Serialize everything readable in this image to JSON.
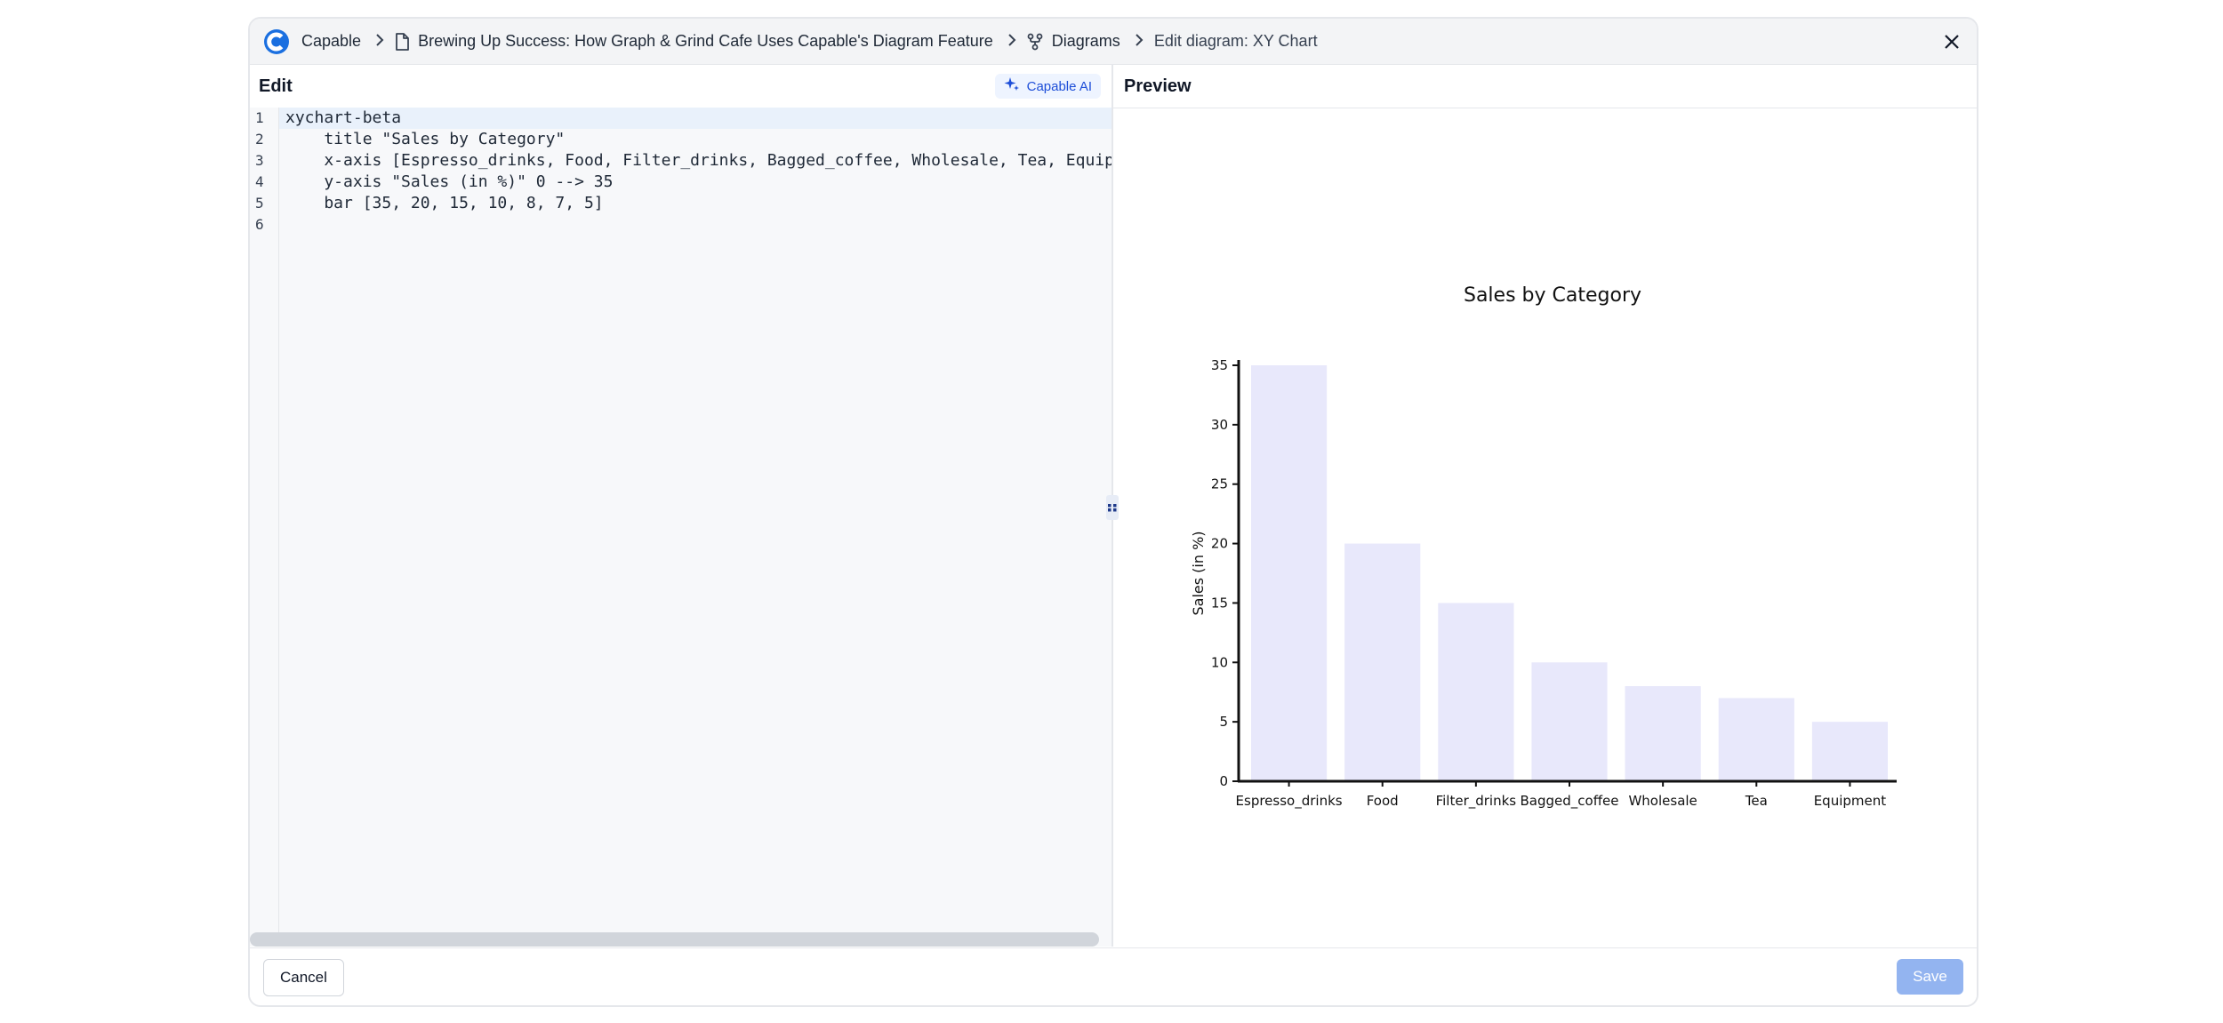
{
  "breadcrumb": {
    "app": "Capable",
    "document": "Brewing Up Success: How Graph & Grind Cafe Uses Capable's Diagram Feature",
    "section": "Diagrams",
    "current": "Edit diagram: XY Chart"
  },
  "edit_pane": {
    "title": "Edit",
    "ai_button": "Capable AI",
    "line_numbers": [
      "1",
      "2",
      "3",
      "4",
      "5",
      "6"
    ],
    "code_lines": [
      "xychart-beta",
      "    title \"Sales by Category\"",
      "    x-axis [Espresso_drinks, Food, Filter_drinks, Bagged_coffee, Wholesale, Tea, Equipment]",
      "    y-axis \"Sales (in %)\" 0 --> 35",
      "    bar [35, 20, 15, 10, 8, 7, 5]",
      ""
    ]
  },
  "preview_pane": {
    "title": "Preview"
  },
  "chart_data": {
    "type": "bar",
    "title": "Sales by Category",
    "categories": [
      "Espresso_drinks",
      "Food",
      "Filter_drinks",
      "Bagged_coffee",
      "Wholesale",
      "Tea",
      "Equipment"
    ],
    "values": [
      35,
      20,
      15,
      10,
      8,
      7,
      5
    ],
    "xlabel": "",
    "ylabel": "Sales (in %)",
    "ylim": [
      0,
      35
    ],
    "yticks": [
      "0",
      "5",
      "10",
      "15",
      "20",
      "25",
      "30",
      "35"
    ],
    "bar_color": "#e8e8fb",
    "axis_color": "#111111"
  },
  "footer": {
    "cancel": "Cancel",
    "save": "Save"
  },
  "colors": {
    "accent": "#1d4ed8",
    "save_disabled": "#93b4f0"
  }
}
